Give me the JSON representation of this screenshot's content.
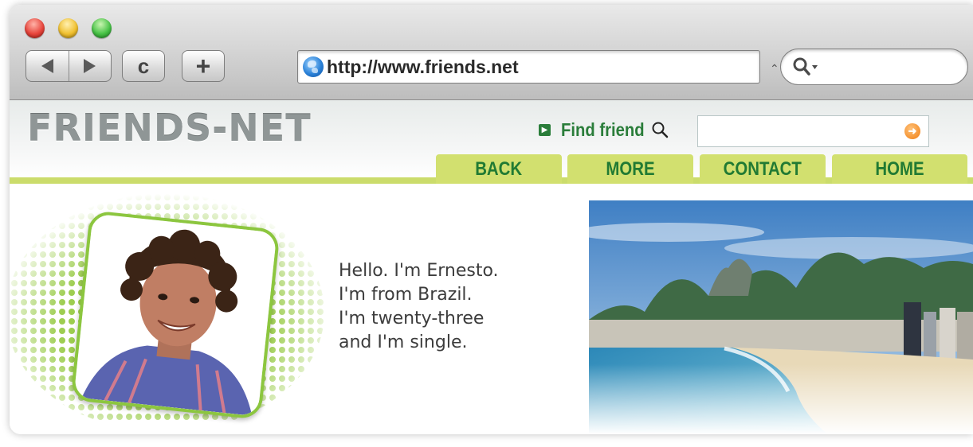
{
  "browser": {
    "url": "http://www.friends.net",
    "reload_glyph": "c",
    "new_tab_glyph": "+",
    "url_dropdown_glyph": "⌃"
  },
  "site": {
    "logo": "FRIENDS-NET",
    "find_label": "Find friend",
    "find_placeholder": "",
    "nav": {
      "back": "BACK",
      "more": "MORE",
      "contact": "CONTACT",
      "home": "HOME"
    }
  },
  "profile": {
    "bio_lines": [
      "Hello. I'm Ernesto.",
      "I'm from Brazil.",
      "I'm twenty-three",
      "and I'm single."
    ]
  },
  "colors": {
    "accent_green": "#217a33",
    "tab_green": "#d2e06f",
    "photo_frame": "#8cc63f"
  },
  "icons": [
    "globe-icon",
    "search-icon",
    "magnifier-icon",
    "arrow-go-icon",
    "back-arrow-icon",
    "forward-arrow-icon"
  ]
}
